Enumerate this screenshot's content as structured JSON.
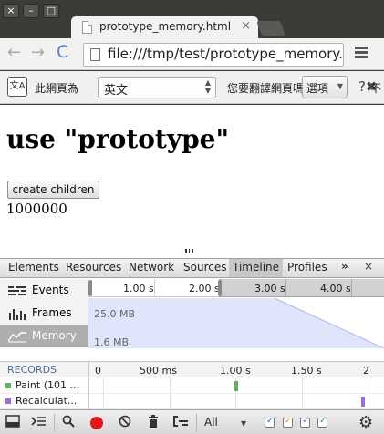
{
  "window": {
    "min_glyph": "–",
    "max_glyph": "□"
  },
  "tab": {
    "title": "prototype_memory.html",
    "close_glyph": "×"
  },
  "toolbar": {
    "back_glyph": "←",
    "forward_glyph": "→",
    "reload_glyph": "C",
    "url": "file:///tmp/test/prototype_memory.html",
    "star_glyph": "☆"
  },
  "translate_bar": {
    "icon_text": "文A",
    "label": "此網頁為",
    "language": "英文",
    "question": "您要翻譯網頁嗎？",
    "options_label": "選項",
    "close_glyph": "?✖",
    "more_text": "不"
  },
  "page": {
    "heading": "use \"prototype\"",
    "button_label": "create children",
    "count": "1000000"
  },
  "devtools": {
    "tabs": [
      {
        "label": "Elements"
      },
      {
        "label": "Resources"
      },
      {
        "label": "Network"
      },
      {
        "label": "Sources"
      },
      {
        "label": "Timeline"
      },
      {
        "label": "Profiles"
      }
    ],
    "more_glyph": "»",
    "close_glyph": "×",
    "overview_items": [
      {
        "label": "Events",
        "icon": "events-icon"
      },
      {
        "label": "Frames",
        "icon": "frames-bars-icon"
      },
      {
        "label": "Memory",
        "icon": "memory-graph-icon"
      }
    ],
    "overview_ticks": [
      "1.00 s",
      "2.00 s",
      "3.00 s",
      "4.00 s"
    ],
    "memory_max": "25.0 MB",
    "memory_min": "1.6 MB",
    "records_title": "RECORDS",
    "record_ticks": [
      "0",
      "500 ms",
      "1.00 s",
      "1.50 s",
      "2"
    ],
    "records": [
      {
        "label": "Paint (101 ...",
        "color": "#5fb25a"
      },
      {
        "label": "Recalculat...",
        "color": "#9c6fd6"
      }
    ],
    "filter_value": "All",
    "colors": {
      "record_red": "#e0161a",
      "graph_fill": "#dfe6fb",
      "graph_line": "#a9b7e6",
      "cb_blue": "#2e6fd4",
      "cb_orange": "#e0a51a",
      "cb_purple": "#8a4fc8",
      "cb_green": "#3e9d3e"
    }
  }
}
